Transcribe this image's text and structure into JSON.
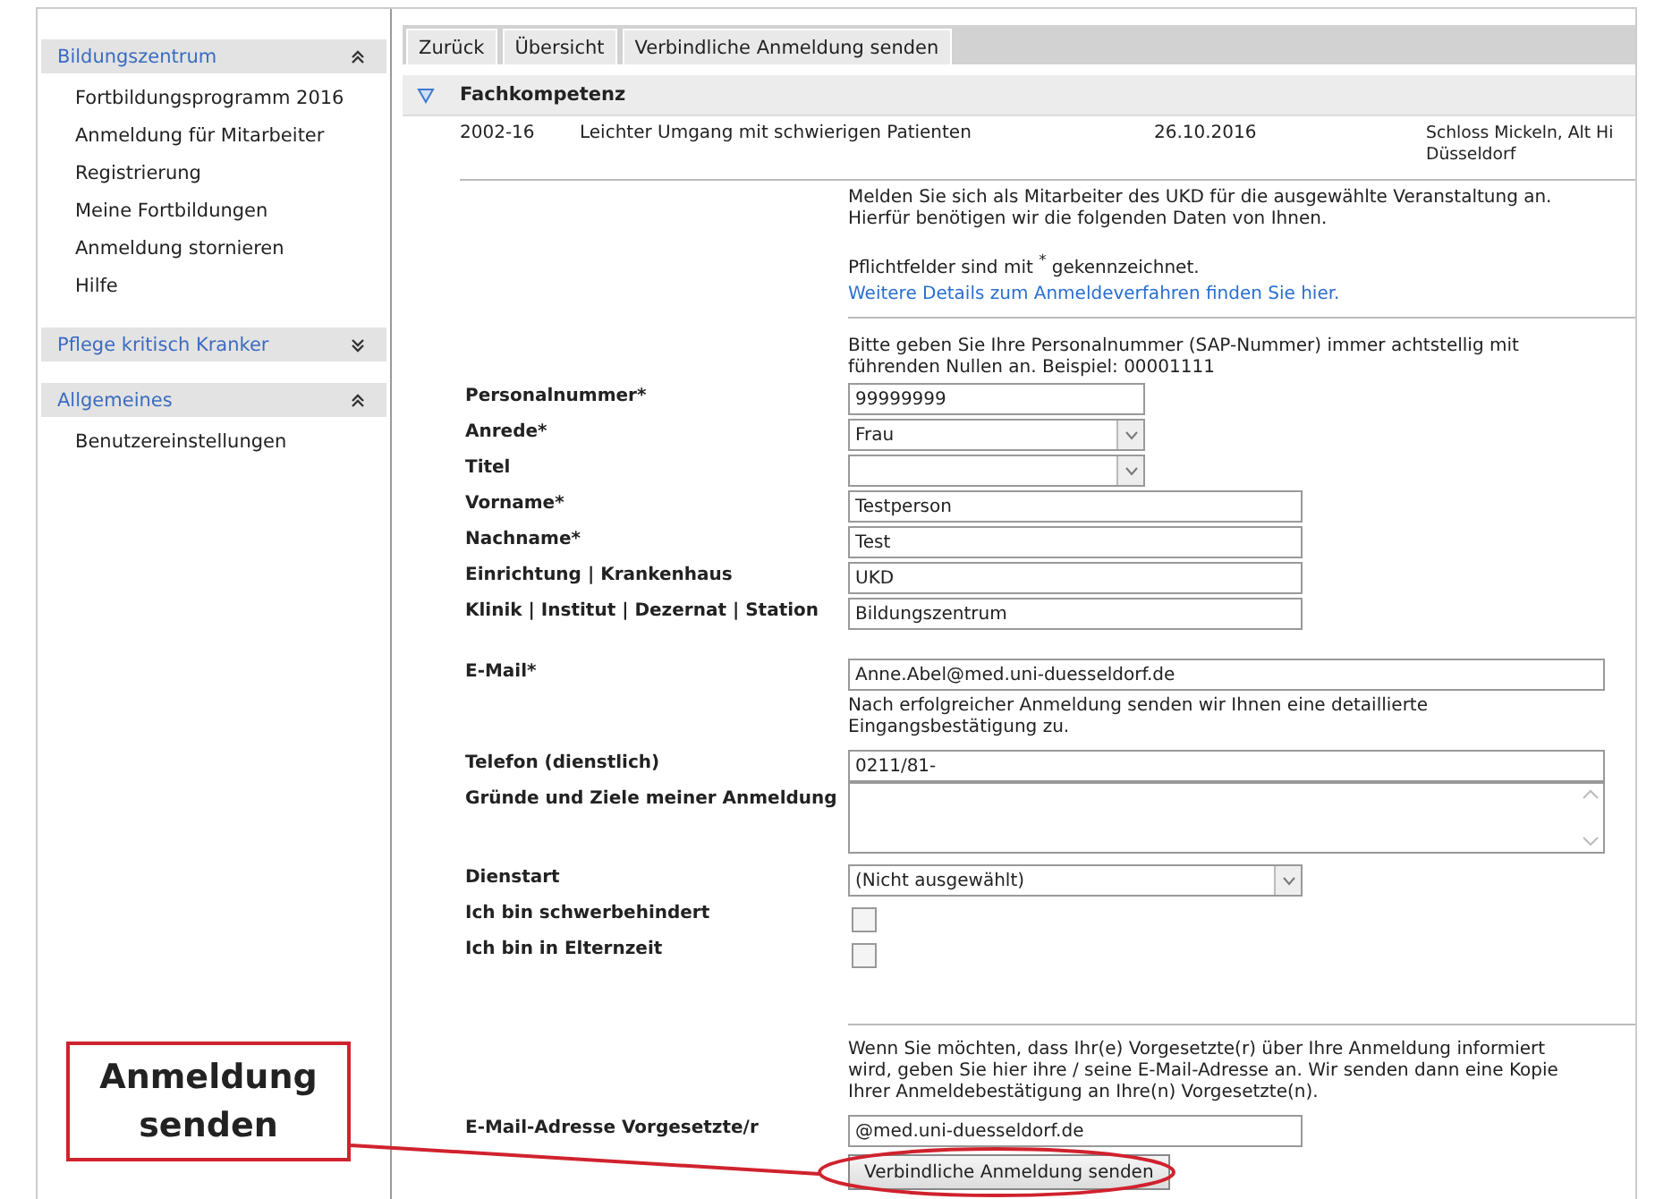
{
  "sidebar": {
    "sections": [
      {
        "title": "Bildungszentrum",
        "expanded": true,
        "items": [
          "Fortbildungsprogramm 2016",
          "Anmeldung für Mitarbeiter",
          "Registrierung",
          "Meine Fortbildungen",
          "Anmeldung stornieren",
          "Hilfe"
        ]
      },
      {
        "title": "Pflege kritisch Kranker",
        "expanded": false
      },
      {
        "title": "Allgemeines",
        "expanded": true,
        "items": [
          "Benutzereinstellungen"
        ]
      }
    ]
  },
  "toolbar": {
    "buttons": [
      "Zurück",
      "Übersicht",
      "Verbindliche Anmeldung senden"
    ]
  },
  "group": {
    "title": "Fachkompetenz",
    "expanded": true,
    "course": {
      "number": "2002-16",
      "title": "Leichter Umgang mit schwierigen Patienten",
      "date": "26.10.2016",
      "location": [
        "Schloss Mickeln, Alt Hi",
        "Düsseldorf"
      ]
    }
  },
  "form": {
    "intro": [
      "Melden Sie sich als Mitarbeiter des UKD für die ausgewählte Veranstaltung an. Hierfür benötigen wir die folgenden Daten von Ihnen.",
      "Pflichtfelder sind mit $^{*}$ gekennzeichnet."
    ],
    "link": "Weitere Details zum Anmeldeverfahren finden Sie hier.",
    "hint": "Bitte geben Sie Ihre Personalnummer (SAP-Nummer) immer achtstellig mit führenden Nullen an. Beispiel: 00001111",
    "fields": [
      {
        "kind": "input",
        "label": "Personalnummer*",
        "value": "99999999"
      },
      {
        "kind": "select",
        "label": "Anrede*",
        "value": "Frau"
      },
      {
        "kind": "select",
        "label": "Titel"
      },
      {
        "kind": "input",
        "label": "Vorname*",
        "value": "Testperson"
      },
      {
        "kind": "input",
        "label": "Nachname*",
        "value": "Test"
      },
      {
        "kind": "input",
        "label": "Einrichtung | Krankenhaus",
        "value": "UKD"
      },
      {
        "kind": "input",
        "label": "Klinik | Institut | Dezernat | Station",
        "value": "Bildungszentrum"
      },
      {
        "kind": "input",
        "label": "E-Mail*",
        "value": "Anne.Abel@med.uni-duesseldorf.de",
        "note": "Nach erfolgreicher Anmeldung senden wir Ihnen eine detaillierte Eingangsbestätigung zu."
      },
      {
        "kind": "input",
        "label": "Telefon (dienstlich)",
        "value": "0211/81-"
      },
      {
        "kind": "textarea",
        "label": "Gründe und Ziele meiner Anmeldung"
      },
      {
        "kind": "select",
        "label": "Dienstart",
        "value": "(Nicht ausgewählt)"
      },
      {
        "kind": "checkbox",
        "label": "Ich bin schwerbehindert",
        "checked": false
      },
      {
        "kind": "checkbox",
        "label": "Ich bin in Elternzeit",
        "checked": false
      }
    ],
    "supervisor": {
      "info": "Wenn Sie möchten, dass Ihr(e) Vorgesetzte(r) über Ihre Anmeldung informiert wird, geben Sie hier ihre / seine E-Mail-Adresse an. Wir senden dann eine Kopie Ihrer Anmeldebestätigung an Ihre(n) Vorgesetzte(n).",
      "label": "E-Mail-Adresse Vorgesetzte/r",
      "value": "@med.uni-duesseldorf.de"
    },
    "submit": "Verbindliche Anmeldung senden"
  },
  "annotation": {
    "callout": "Anmeldung senden"
  }
}
